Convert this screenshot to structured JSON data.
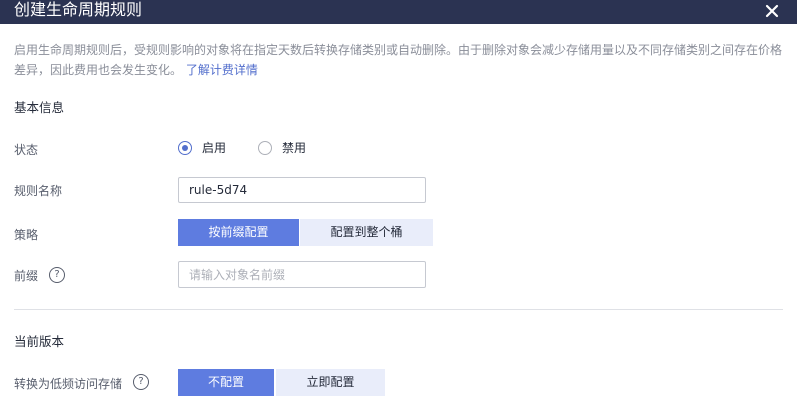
{
  "dialog": {
    "title": "创建生命周期规则",
    "notice_text": "启用生命周期规则后，受规则影响的对象将在指定天数后转换存储类别或自动删除。由于删除对象会减少存储用量以及不同存储类别之间存在价格差异，因此费用也会发生变化。",
    "notice_link": "了解计费详情"
  },
  "basic": {
    "section_title": "基本信息",
    "status_label": "状态",
    "status_options": [
      "启用",
      "禁用"
    ],
    "status_selected": "启用",
    "rule_name_label": "规则名称",
    "rule_name_value": "rule-5d74",
    "policy_label": "策略",
    "policy_options": [
      "按前缀配置",
      "配置到整个桶"
    ],
    "policy_selected": "按前缀配置",
    "prefix_label": "前缀",
    "prefix_placeholder": "请输入对象名前缀",
    "help_glyph": "?"
  },
  "current_version": {
    "section_title": "当前版本",
    "transition_label": "转换为低频访问存储",
    "transition_options": [
      "不配置",
      "立即配置"
    ],
    "transition_selected": "不配置"
  },
  "colors": {
    "header_bg": "#2b3352",
    "primary": "#5e7ce0",
    "link": "#526ecc"
  },
  "icons": {
    "close": "close-icon",
    "help": "help-icon"
  }
}
